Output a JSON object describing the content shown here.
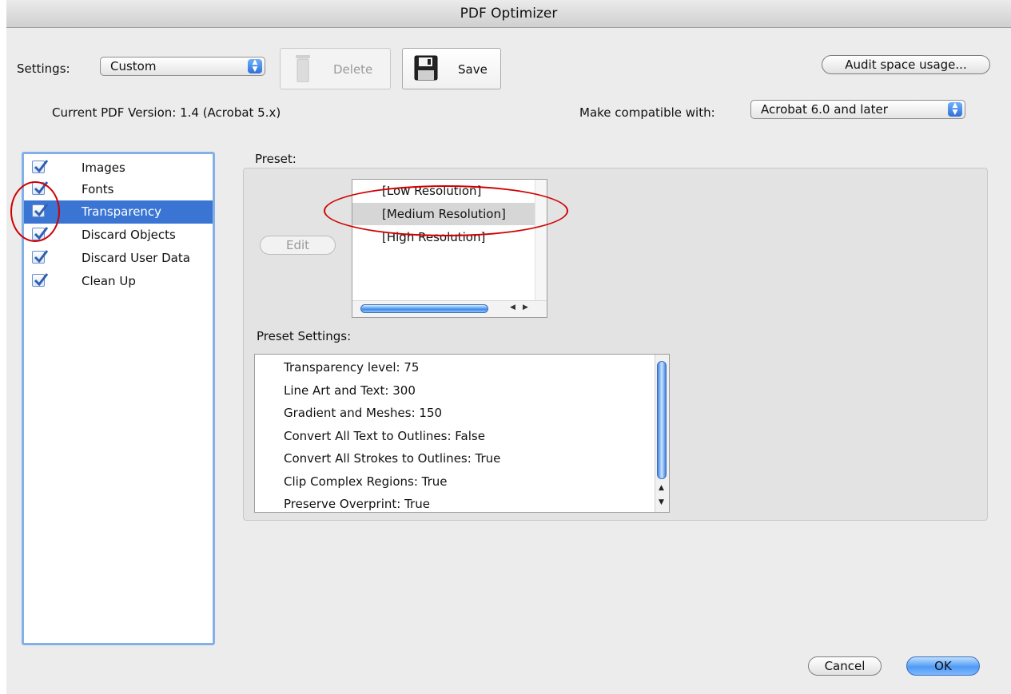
{
  "window": {
    "title": "PDF Optimizer"
  },
  "toolbar": {
    "settings_label": "Settings:",
    "settings_value": "Custom",
    "delete_label": "Delete",
    "save_label": "Save",
    "audit_label": "Audit space usage..."
  },
  "version": {
    "current_label": "Current PDF Version: 1.4 (Acrobat 5.x)",
    "compat_label": "Make compatible with:",
    "compat_value": "Acrobat 6.0 and later"
  },
  "sidebar": {
    "items": [
      {
        "label": "Images",
        "checked": true
      },
      {
        "label": "Fonts",
        "checked": true
      },
      {
        "label": "Transparency",
        "checked": true,
        "selected": true
      },
      {
        "label": "Discard Objects",
        "checked": true
      },
      {
        "label": "Discard User Data",
        "checked": true
      },
      {
        "label": "Clean Up",
        "checked": true
      }
    ]
  },
  "preset": {
    "label": "Preset:",
    "edit_label": "Edit",
    "items": [
      "[Low Resolution]",
      "[Medium Resolution]",
      "[High Resolution]"
    ],
    "selected": "[Medium Resolution]"
  },
  "preset_settings": {
    "label": "Preset Settings:",
    "rows": [
      "Transparency level: 75",
      "Line Art and Text: 300",
      "Gradient and Meshes: 150",
      "Convert All Text to Outlines: False",
      "Convert All Strokes to Outlines: True",
      "Clip Complex Regions: True",
      "Preserve Overprint: True"
    ]
  },
  "footer": {
    "cancel_label": "Cancel",
    "ok_label": "OK"
  },
  "colors": {
    "selection": "#3b75d4",
    "annotation": "#d00000",
    "default_button": "#4f9af5"
  }
}
